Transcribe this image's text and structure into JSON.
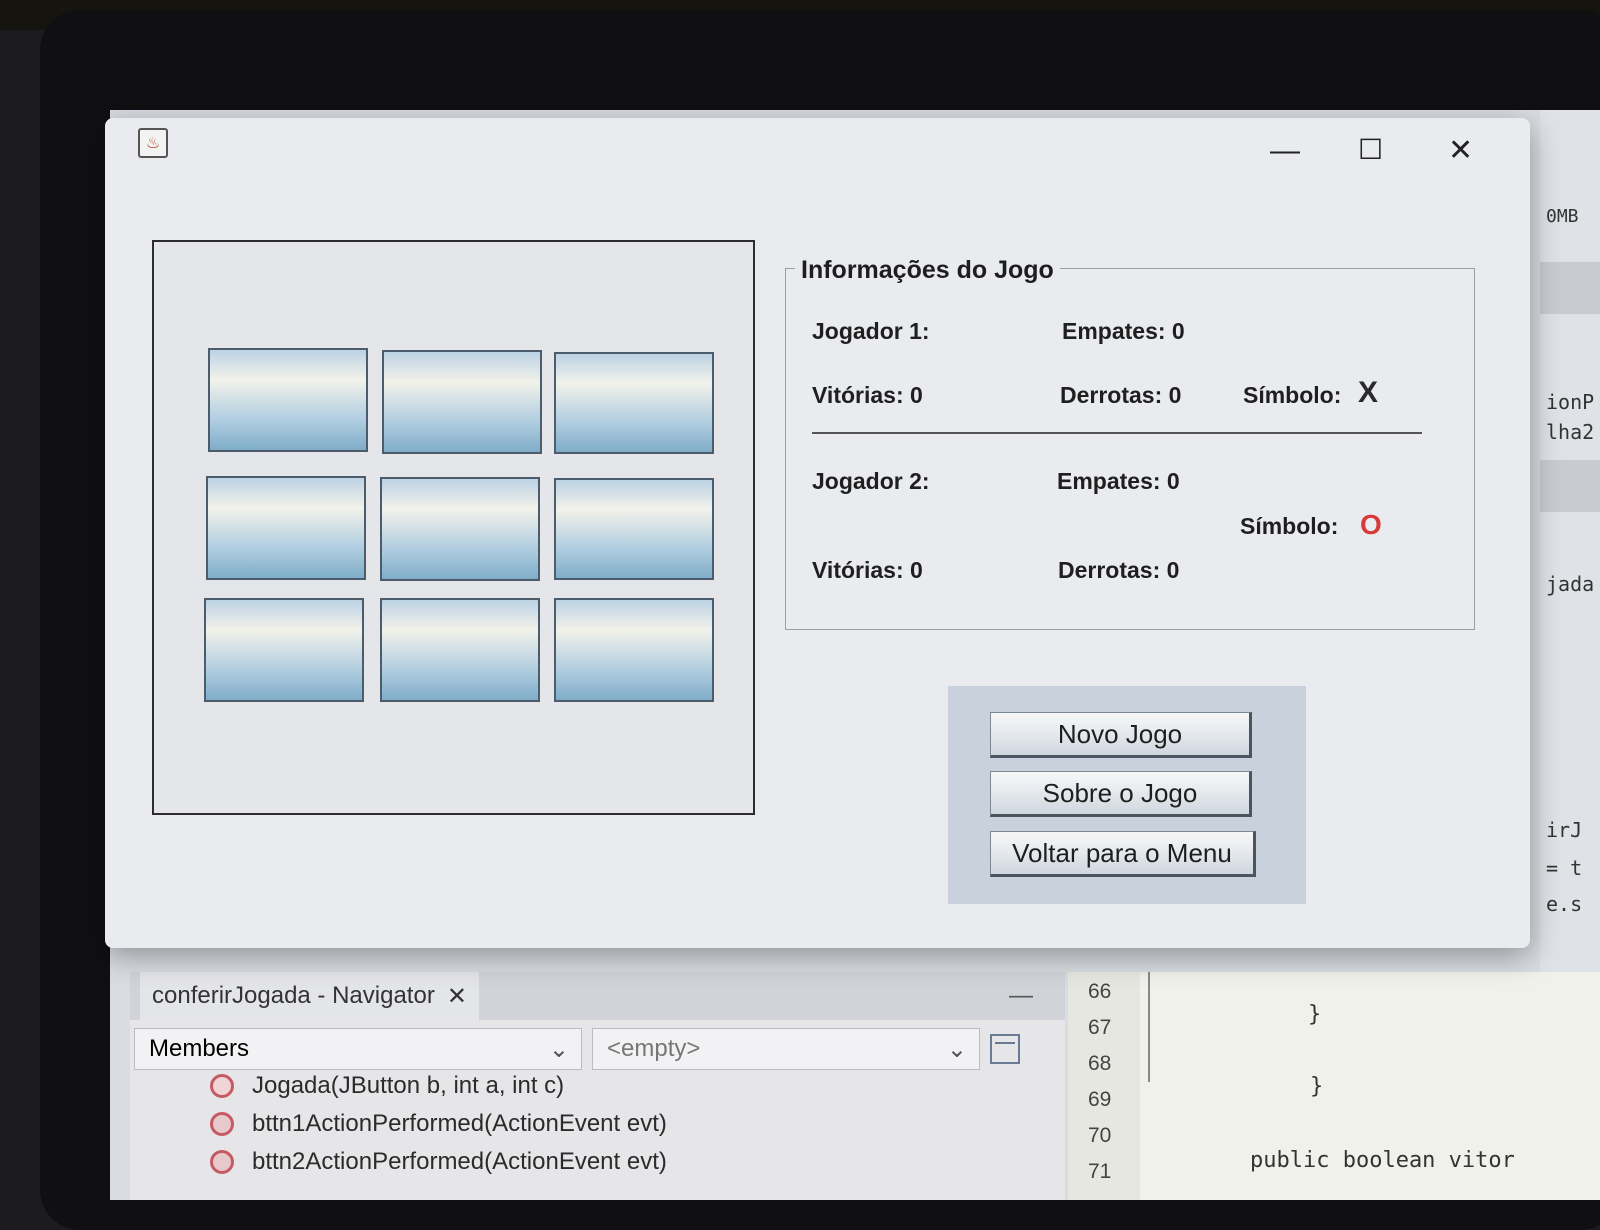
{
  "window": {
    "app_icon": "java-cup-icon",
    "controls": {
      "minimize": "—",
      "maximize": "☐",
      "close": "✕"
    }
  },
  "board": {
    "cells": [
      "",
      "",
      "",
      "",
      "",
      "",
      "",
      "",
      ""
    ]
  },
  "info": {
    "title": "Informações do Jogo",
    "player1": {
      "label": "Jogador 1:",
      "empates": "Empates: 0",
      "vitorias": "Vitórias: 0",
      "derrotas": "Derrotas: 0",
      "simbolo_label": "Símbolo:",
      "simbolo": "X"
    },
    "player2": {
      "label": "Jogador 2:",
      "empates": "Empates: 0",
      "vitorias": "Vitórias: 0",
      "derrotas": "Derrotas: 0",
      "simbolo_label": "Símbolo:",
      "simbolo": "O"
    },
    "colors": {
      "symbol_o": "#d83a3a",
      "symbol_x": "#2a2a2a"
    }
  },
  "buttons": {
    "novo_jogo": "Novo Jogo",
    "sobre_jogo": "Sobre o Jogo",
    "voltar_menu": "Voltar para o Menu"
  },
  "ide": {
    "memory": "0MB",
    "right_snippets": [
      "ionP",
      "lha2",
      "jada",
      "irJ",
      "= t",
      "e.s"
    ],
    "navigator": {
      "tab": "conferirJogada - Navigator",
      "tab_close": "✕",
      "members_combo": "Members",
      "filter_combo": "<empty>",
      "members": [
        "Jogada(JButton b, int a, int c)",
        "bttn1ActionPerformed(ActionEvent evt)",
        "bttn2ActionPerformed(ActionEvent evt)"
      ]
    },
    "editor": {
      "lines": [
        "66",
        "67",
        "68",
        "69",
        "70",
        "71"
      ],
      "code": [
        "",
        "}",
        "",
        "}",
        "",
        "public boolean vitor"
      ]
    }
  }
}
